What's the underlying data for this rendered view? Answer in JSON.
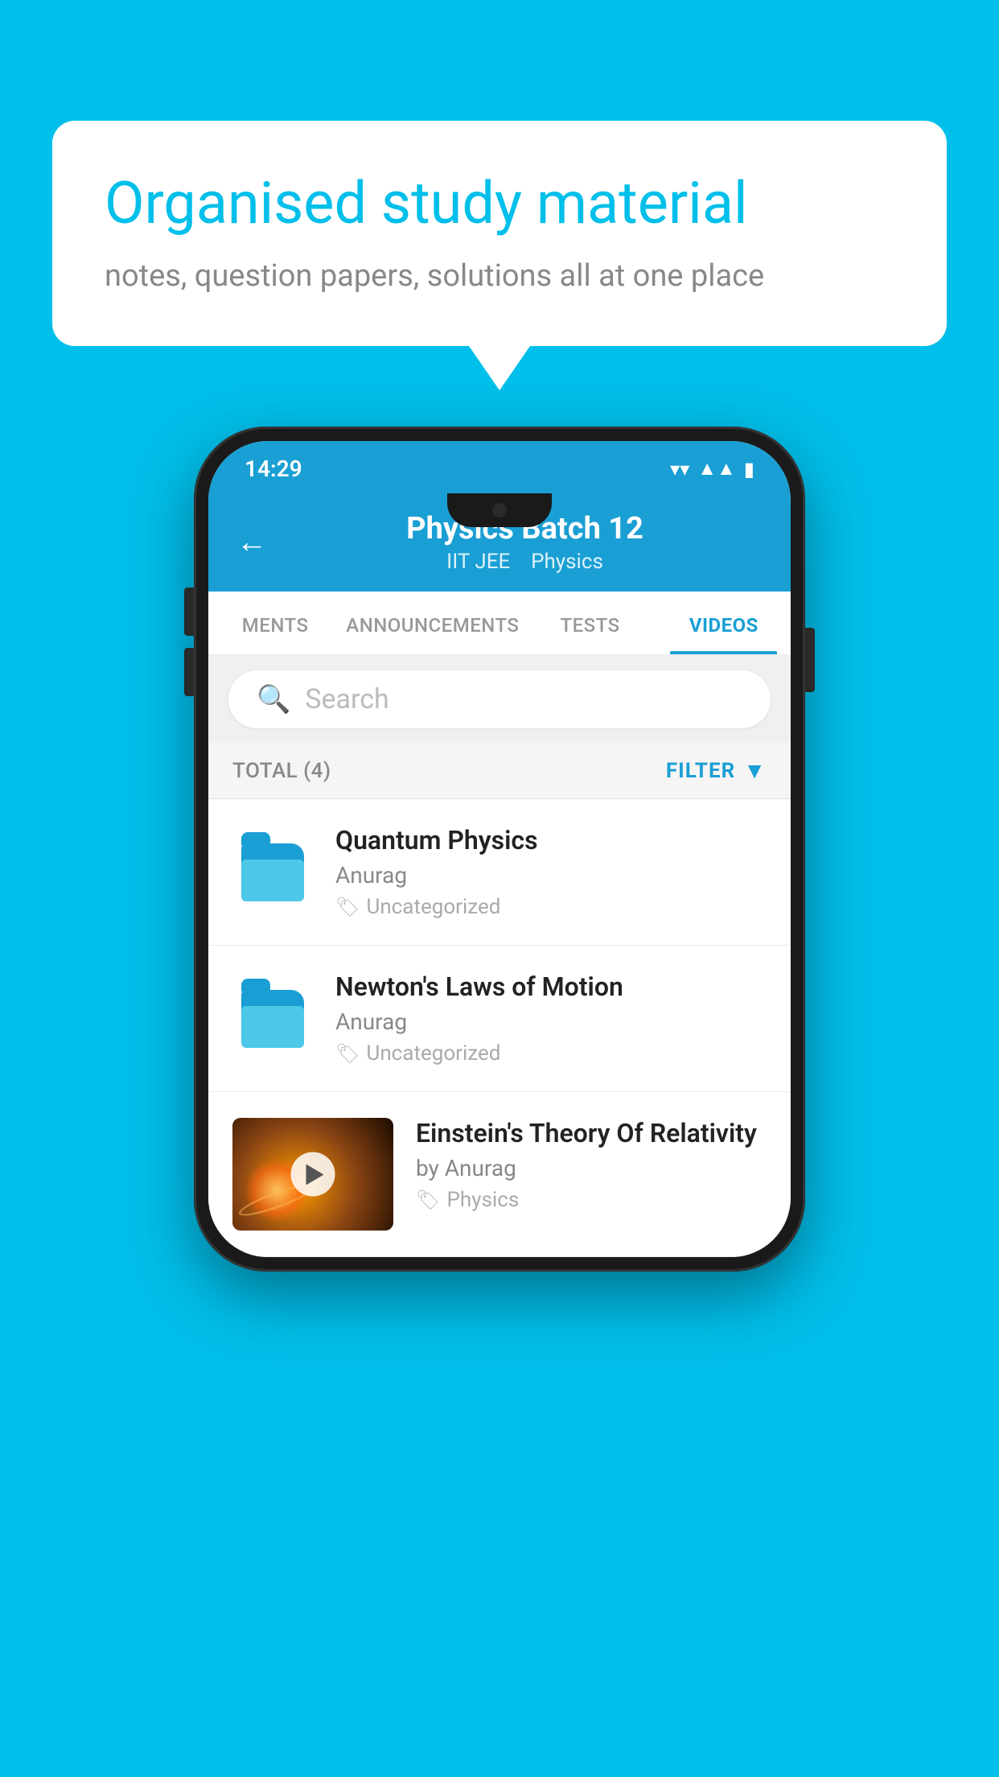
{
  "background_color": "#00BFEA",
  "bubble": {
    "title": "Organised study material",
    "subtitle": "notes, question papers, solutions all at one place"
  },
  "phone": {
    "status_bar": {
      "time": "14:29",
      "icons": [
        "wifi",
        "signal",
        "battery"
      ]
    },
    "header": {
      "title": "Physics Batch 12",
      "subtitle_part1": "IIT JEE",
      "subtitle_part2": "Physics",
      "back_label": "←"
    },
    "tabs": [
      {
        "label": "MENTS",
        "active": false
      },
      {
        "label": "ANNOUNCEMENTS",
        "active": false
      },
      {
        "label": "TESTS",
        "active": false
      },
      {
        "label": "VIDEOS",
        "active": true
      }
    ],
    "search": {
      "placeholder": "Search"
    },
    "filter_bar": {
      "total_label": "TOTAL (4)",
      "filter_label": "FILTER"
    },
    "videos": [
      {
        "title": "Quantum Physics",
        "author": "Anurag",
        "tag": "Uncategorized",
        "type": "folder"
      },
      {
        "title": "Newton's Laws of Motion",
        "author": "Anurag",
        "tag": "Uncategorized",
        "type": "folder"
      },
      {
        "title": "Einstein's Theory Of Relativity",
        "author": "by Anurag",
        "tag": "Physics",
        "type": "video"
      }
    ]
  }
}
